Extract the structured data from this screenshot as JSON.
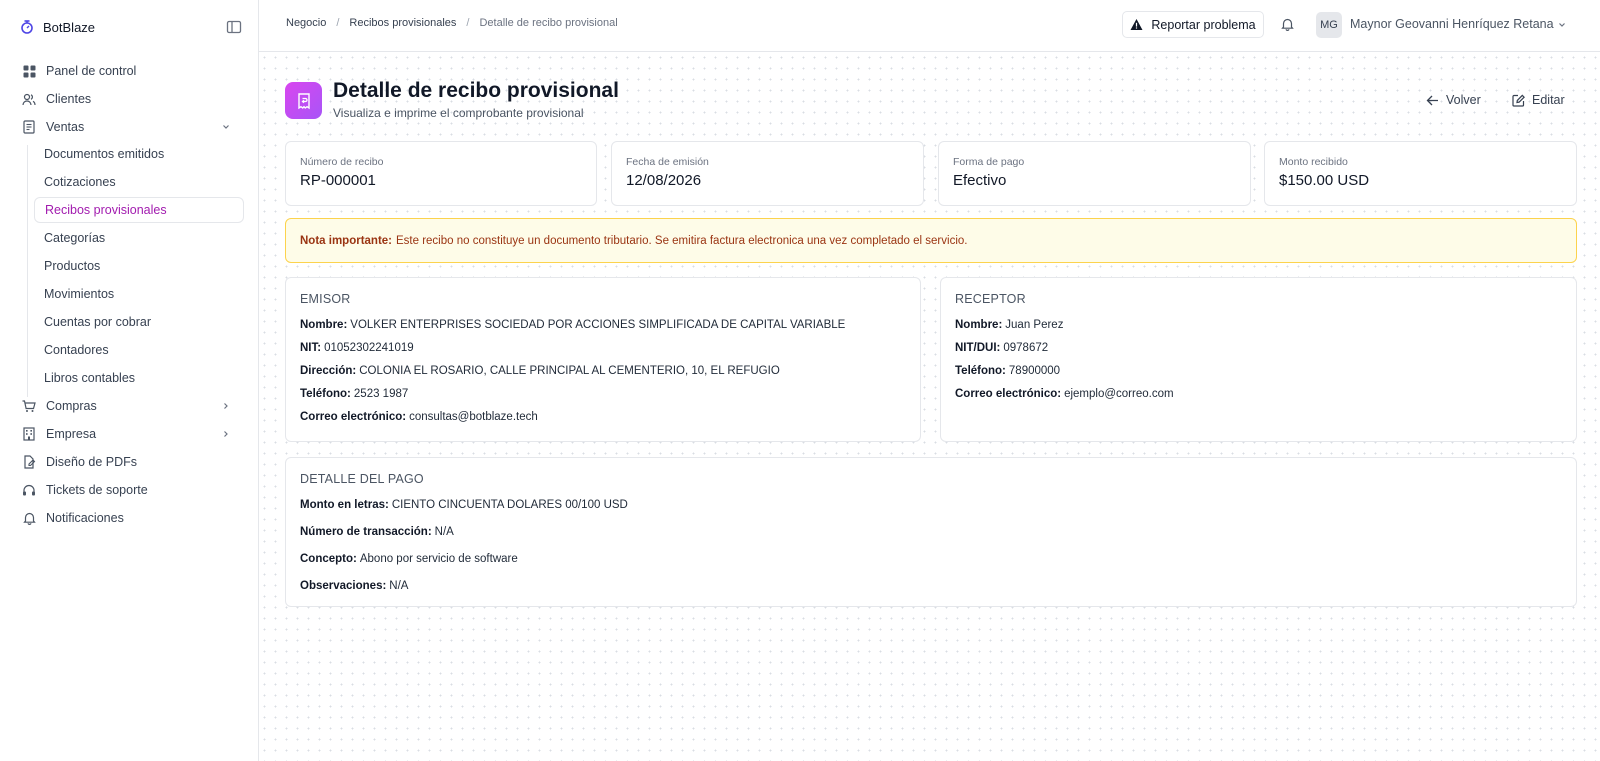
{
  "app": {
    "name": "BotBlaze"
  },
  "sidebar": {
    "items": [
      {
        "label": "Panel de control",
        "icon": "dashboard-icon"
      },
      {
        "label": "Clientes",
        "icon": "users-icon"
      },
      {
        "label": "Ventas",
        "icon": "receipt-icon"
      }
    ],
    "sub_items": [
      {
        "label": "Documentos emitidos"
      },
      {
        "label": "Cotizaciones"
      },
      {
        "label": "Recibos provisionales",
        "active": true
      },
      {
        "label": "Categorías"
      },
      {
        "label": "Productos"
      },
      {
        "label": "Movimientos"
      },
      {
        "label": "Cuentas por cobrar"
      },
      {
        "label": "Contadores"
      },
      {
        "label": "Libros contables"
      }
    ],
    "bottom_items": [
      {
        "label": "Compras",
        "icon": "cart-icon"
      },
      {
        "label": "Empresa",
        "icon": "building-icon"
      },
      {
        "label": "Diseño de PDFs",
        "icon": "file-design-icon"
      },
      {
        "label": "Tickets de soporte",
        "icon": "headset-icon"
      },
      {
        "label": "Notificaciones",
        "icon": "bell-icon"
      }
    ]
  },
  "breadcrumb": [
    "Negocio",
    "Recibos provisionales",
    "Detalle de recibo provisional"
  ],
  "topbar": {
    "report_label": "Reportar problema",
    "user_initials": "MG",
    "user_name": "Maynor Geovanni Henríquez Retana"
  },
  "page": {
    "title": "Detalle de recibo provisional",
    "subtitle": "Visualiza e imprime el comprobante provisional",
    "back_label": "Volver",
    "edit_label": "Editar"
  },
  "stats": [
    {
      "label": "Número de recibo",
      "value": "RP-000001"
    },
    {
      "label": "Fecha de emisión",
      "value": "12/08/2026"
    },
    {
      "label": "Forma de pago",
      "value": "Efectivo"
    },
    {
      "label": "Monto recibido",
      "value": "$150.00 USD"
    }
  ],
  "note": {
    "title": "Nota importante:",
    "text": "Este recibo no constituye un documento tributario. Se emitira factura electronica una vez completado el servicio."
  },
  "emisor": {
    "title": "EMISOR",
    "fields": [
      {
        "key": "Nombre:",
        "value": "VOLKER ENTERPRISES SOCIEDAD POR ACCIONES SIMPLIFICADA DE CAPITAL VARIABLE"
      },
      {
        "key": "NIT:",
        "value": "01052302241019"
      },
      {
        "key": "Dirección:",
        "value": "COLONIA EL ROSARIO, CALLE PRINCIPAL AL CEMENTERIO, 10, EL REFUGIO"
      },
      {
        "key": "Teléfono:",
        "value": "2523 1987"
      },
      {
        "key": "Correo electrónico:",
        "value": "consultas@botblaze.tech"
      }
    ]
  },
  "receptor": {
    "title": "RECEPTOR",
    "fields": [
      {
        "key": "Nombre:",
        "value": "Juan Perez"
      },
      {
        "key": "NIT/DUI:",
        "value": "0978672"
      },
      {
        "key": "Teléfono:",
        "value": "78900000"
      },
      {
        "key": "Correo electrónico:",
        "value": "ejemplo@correo.com"
      }
    ]
  },
  "payment": {
    "title": "DETALLE DEL PAGO",
    "fields": [
      {
        "key": "Monto en letras:",
        "value": "CIENTO CINCUENTA DOLARES 00/100 USD"
      },
      {
        "key": "Número de transacción:",
        "value": "N/A"
      },
      {
        "key": "Concepto:",
        "value": "Abono por servicio de software"
      },
      {
        "key": "Observaciones:",
        "value": "N/A"
      }
    ]
  },
  "colors": {
    "accent": "#a21caf",
    "warning_bg": "#fefce8",
    "warning_border": "#fcd34d",
    "warning_text": "#9a3412"
  }
}
